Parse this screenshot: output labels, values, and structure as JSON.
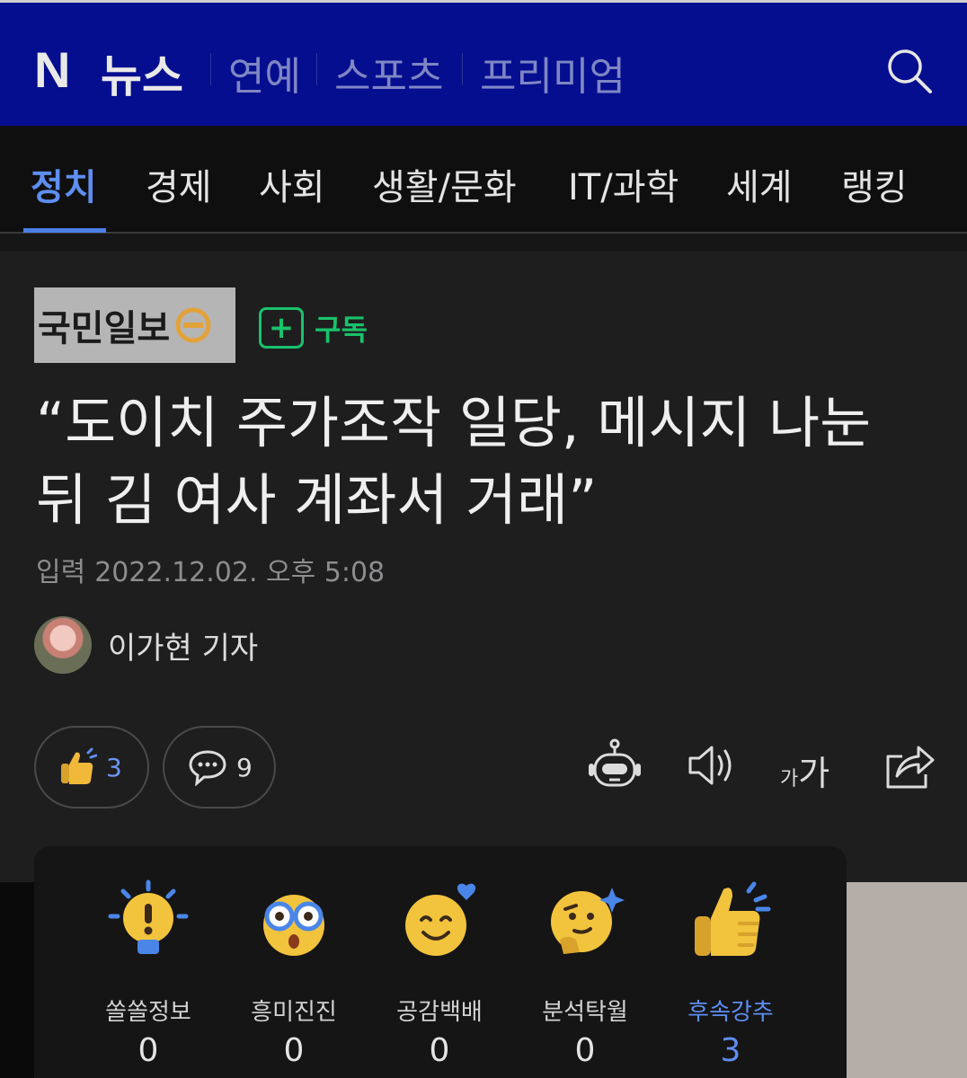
{
  "header": {
    "logo_n": "N",
    "logo_news": "뉴스",
    "nav": [
      "연예",
      "스포츠",
      "프리미엄"
    ]
  },
  "categories": [
    "정치",
    "경제",
    "사회",
    "생활/문화",
    "IT/과학",
    "세계",
    "랭킹"
  ],
  "active_category": "정치",
  "article": {
    "press_name": "국민일보",
    "subscribe_label": "구독",
    "subscribe_plus": "+",
    "headline_line1": "“도이치 주가조작 일당, 메시지 나눈",
    "headline_line2": "뒤 김 여사 계좌서 거래”",
    "date_label": "입력",
    "date_value": "2022.12.02. 오후 5:08",
    "reporter": "이가현 기자"
  },
  "actions": {
    "reaction_count": "3",
    "comment_count": "9",
    "font_size_label_small": "가",
    "font_size_label_large": "가"
  },
  "reactions": [
    {
      "label": "쏠쏠정보",
      "count": "0",
      "icon": "lightbulb-icon"
    },
    {
      "label": "흥미진진",
      "count": "0",
      "icon": "glasses-face-icon"
    },
    {
      "label": "공감백배",
      "count": "0",
      "icon": "smile-heart-icon"
    },
    {
      "label": "분석탁월",
      "count": "0",
      "icon": "thinking-face-icon"
    },
    {
      "label": "후속강추",
      "count": "3",
      "icon": "thumbs-up-icon",
      "selected": true
    }
  ],
  "colors": {
    "header_bg": "#050e8f",
    "accent_blue": "#5e8ef0",
    "subscribe_green": "#19c26b",
    "background": "#1e1e1f"
  }
}
